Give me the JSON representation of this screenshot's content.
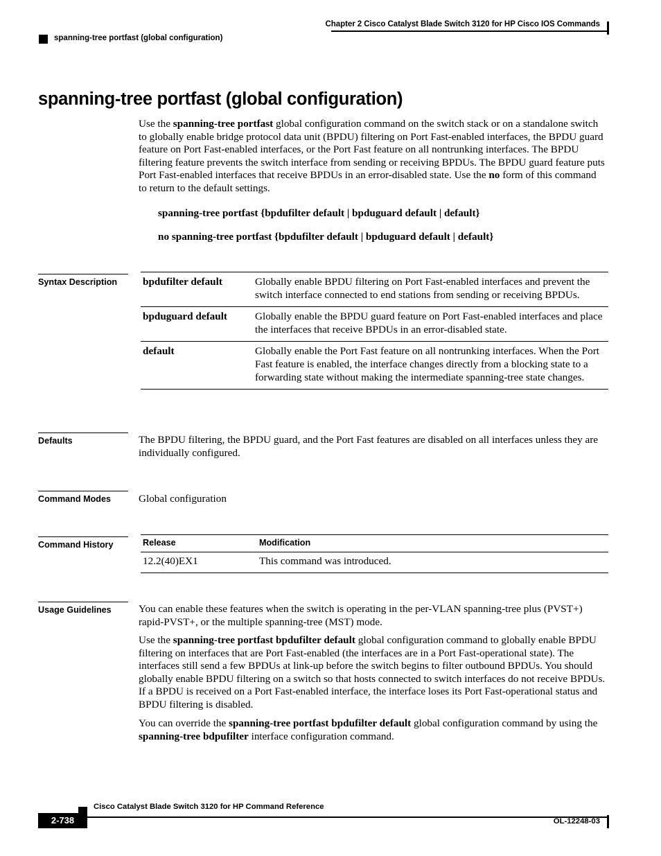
{
  "header": {
    "chapter": "Chapter  2  Cisco Catalyst Blade Switch 3120 for HP Cisco IOS Commands",
    "running_head": "spanning-tree portfast (global configuration)"
  },
  "title": "spanning-tree portfast (global configuration)",
  "intro": "Use the spanning-tree portfast global configuration command on the switch stack or on a standalone switch to globally enable bridge protocol data unit (BPDU) filtering on Port Fast-enabled interfaces, the BPDU guard feature on Port Fast-enabled interfaces, or the Port Fast feature on all nontrunking interfaces. The BPDU filtering feature prevents the switch interface from sending or receiving BPDUs. The BPDU guard feature puts Port Fast-enabled interfaces that receive BPDUs in an error-disabled state. Use the no form of this command to return to the default settings.",
  "syntax": {
    "line1": "spanning-tree portfast {bpdufilter default | bpduguard default | default}",
    "line2": "no spanning-tree portfast {bpdufilter default | bpduguard default | default}"
  },
  "sections": {
    "syntax_description": "Syntax Description",
    "defaults": "Defaults",
    "command_modes": "Command Modes",
    "command_history": "Command History",
    "usage_guidelines": "Usage Guidelines"
  },
  "syntax_description_rows": [
    {
      "term": "bpdufilter default",
      "desc": "Globally enable BPDU filtering on Port Fast-enabled interfaces and prevent the switch interface connected to end stations from sending or receiving BPDUs."
    },
    {
      "term": "bpduguard default",
      "desc": "Globally enable the BPDU guard feature on Port Fast-enabled interfaces and place the interfaces that receive BPDUs in an error-disabled state."
    },
    {
      "term": "default",
      "desc": "Globally enable the Port Fast feature on all nontrunking interfaces. When the Port Fast feature is enabled, the interface changes directly from a blocking state to a forwarding state without making the intermediate spanning-tree state changes."
    }
  ],
  "defaults_text": "The BPDU filtering, the BPDU guard, and the Port Fast features are disabled on all interfaces unless they are individually configured.",
  "command_modes_text": "Global configuration",
  "command_history_table": {
    "headers": [
      "Release",
      "Modification"
    ],
    "rows": [
      [
        "12.2(40)EX1",
        "This command was introduced."
      ]
    ]
  },
  "usage_guidelines": {
    "p1": "You can enable these features when the switch is operating in the per-VLAN spanning-tree plus (PVST+) rapid-PVST+, or the multiple spanning-tree (MST) mode.",
    "p2_a": "Use the ",
    "p2_b": "spanning-tree portfast bpdufilter default",
    "p2_c": " global configuration command to globally enable BPDU filtering on interfaces that are Port Fast-enabled (the interfaces are in a Port Fast-operational state). The interfaces still send a few BPDUs at link-up before the switch begins to filter outbound BPDUs. You should globally enable BPDU filtering on a switch so that hosts connected to switch interfaces do not receive BPDUs. If a BPDU is received on a Port Fast-enabled interface, the interface loses its Port Fast-operational status and BPDU filtering is disabled.",
    "p3_a": "You can override the ",
    "p3_b": "spanning-tree portfast bpdufilter default",
    "p3_c": " global configuration command by using the ",
    "p3_d": "spanning-tree bdpufilter",
    "p3_e": " interface configuration command."
  },
  "footer": {
    "doc_title": "Cisco Catalyst Blade Switch 3120 for HP Command Reference",
    "page_number": "2-738",
    "doc_number": "OL-12248-03"
  }
}
